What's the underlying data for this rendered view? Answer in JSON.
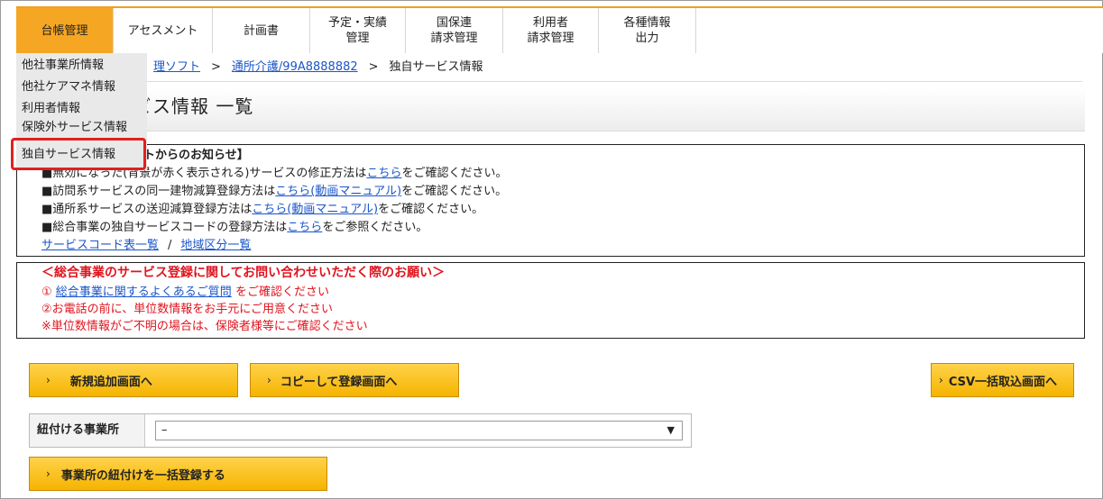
{
  "nav": {
    "items": [
      {
        "label1": "台帳管理",
        "label2": ""
      },
      {
        "label1": "アセスメント",
        "label2": ""
      },
      {
        "label1": "計画書",
        "label2": ""
      },
      {
        "label1": "予定・実績",
        "label2": "管理"
      },
      {
        "label1": "国保連",
        "label2": "請求管理"
      },
      {
        "label1": "利用者",
        "label2": "請求管理"
      },
      {
        "label1": "各種情報",
        "label2": "出力"
      }
    ]
  },
  "dropdown": {
    "items": [
      "他社事業所情報",
      "他社ケアマネ情報",
      "利用者情報",
      "保険外サービス情報",
      "独自サービス情報"
    ]
  },
  "breadcrumb": {
    "link1": "理ソフト",
    "sep": ">",
    "link2": "通所介護/99A8888882",
    "current": "独自サービス情報"
  },
  "page": {
    "title": "ビス情報 一覧"
  },
  "notice": {
    "heading": "ートからのお知らせ】",
    "line1_pre": "■無効になった(背景が赤く表示される)サービスの修正方法は",
    "line1_link": "こちら",
    "line1_post": "をご確認ください。",
    "line2_pre": "■訪問系サービスの同一建物減算登録方法は",
    "line2_link": "こちら(動画マニュアル)",
    "line2_post": "をご確認ください。",
    "line3_pre": "■通所系サービスの送迎減算登録方法は",
    "line3_link": "こちら(動画マニュアル)",
    "line3_post": "をご確認ください。",
    "line4_pre": "■総合事業の独自サービスコードの登録方法は",
    "line4_link": "こちら",
    "line4_post": "をご参照ください。",
    "link_a": "サービスコード表一覧",
    "slash": "/",
    "link_b": "地域区分一覧"
  },
  "warning": {
    "heading": "＜総合事業のサービス登録に関してお問い合わせいただく際のお願い＞",
    "line1_pre": "① ",
    "line1_link": "総合事業に関するよくあるご質問",
    "line1_post": " をご確認ください",
    "line2": "②お電話の前に、単位数情報をお手元にご用意ください",
    "line3": "※単位数情報がご不明の場合は、保険者様等にご確認ください"
  },
  "buttons": {
    "chevron": "›",
    "new": "新規追加画面へ",
    "copy": "コピーして登録画面へ",
    "csv": "CSV一括取込画面へ",
    "bulk": "事業所の紐付けを一括登録する"
  },
  "office_select": {
    "label": "紐付ける事業所",
    "value": "–",
    "arrow": "▼"
  },
  "colors": {
    "accent": "#f5a623",
    "link": "#1a56c9",
    "warning": "#e0141e",
    "highlight_border": "#e02020"
  }
}
